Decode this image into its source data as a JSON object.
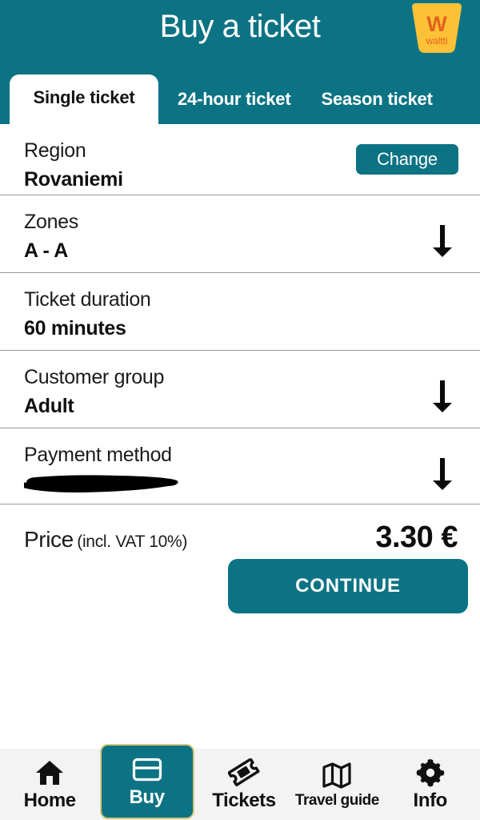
{
  "header": {
    "title": "Buy a ticket",
    "logo": {
      "brand": "waltti",
      "mark": "W",
      "bg_color": "#fdc138",
      "fg_color": "#e2621b"
    },
    "bg_color": "#0c7384"
  },
  "tabs": [
    {
      "label": "Single ticket",
      "active": true
    },
    {
      "label": "24-hour ticket",
      "active": false
    },
    {
      "label": "Season ticket",
      "active": false
    }
  ],
  "rows": [
    {
      "label": "Region",
      "value": "Rovaniemi",
      "action": "Change",
      "action_icon": "none"
    },
    {
      "label": "Zones",
      "value": "A - A",
      "action_icon": "arrow-down-icon"
    },
    {
      "label": "Ticket duration",
      "value": "60 minutes",
      "action_icon": "none"
    },
    {
      "label": "Customer group",
      "value": "Adult",
      "action_icon": "arrow-down-icon"
    },
    {
      "label": "Payment method",
      "value": "",
      "redacted": true,
      "action_icon": "arrow-down-icon"
    }
  ],
  "price": {
    "label": "Price",
    "vat_note": "(incl. VAT 10%)",
    "amount": "3.30 €"
  },
  "continue_button": {
    "label": "CONTINUE",
    "color": "#0c7384"
  },
  "bottom_nav": {
    "bg_color": "#f3f3f3",
    "active_color": "#0c7384",
    "active_border_color": "#d8c978",
    "items": [
      {
        "label": "Home",
        "icon": "home-icon",
        "active": false
      },
      {
        "label": "Buy",
        "icon": "credit-card-icon",
        "active": true
      },
      {
        "label": "Tickets",
        "icon": "ticket-icon",
        "active": false
      },
      {
        "label": "Travel guide",
        "icon": "map-icon",
        "active": false
      },
      {
        "label": "Info",
        "icon": "gear-icon",
        "active": false
      }
    ]
  }
}
